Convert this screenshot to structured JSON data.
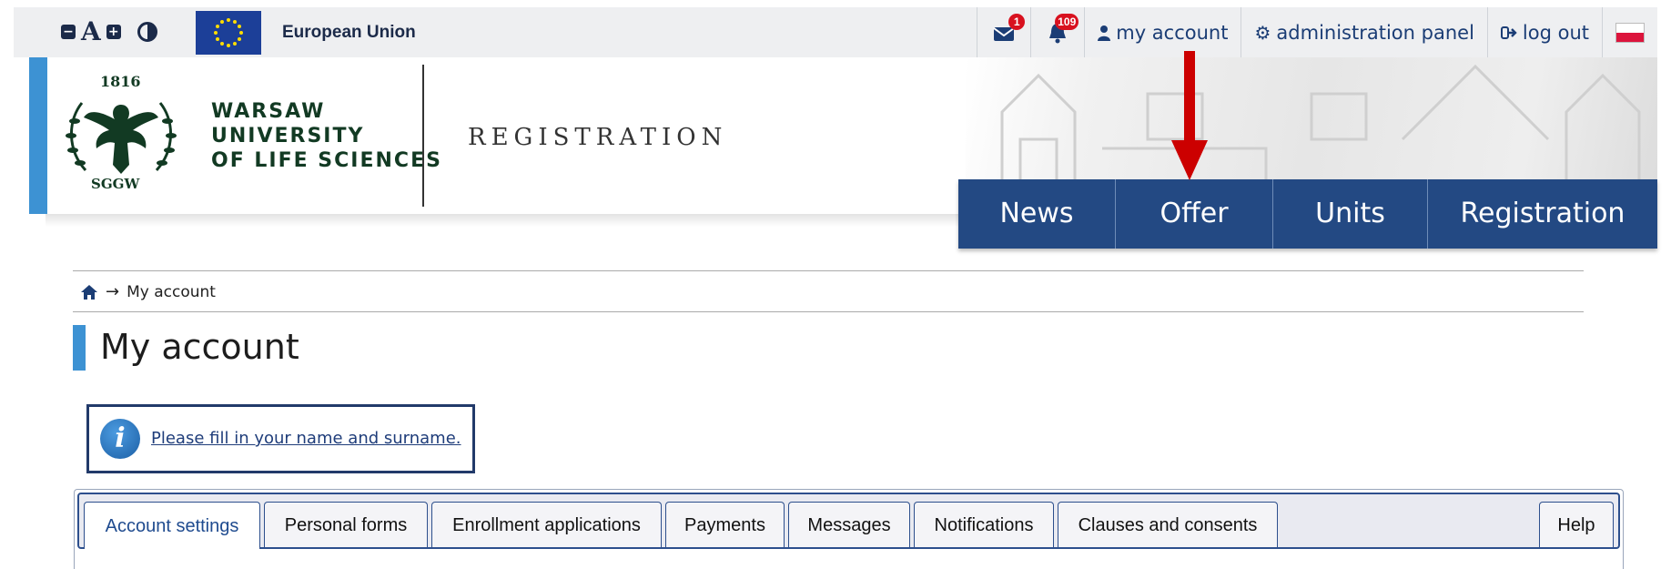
{
  "accessibility": {
    "decrease_font": "A−",
    "font_label": "A",
    "increase_font": "A+",
    "contrast": "contrast"
  },
  "eu": {
    "label": "European Union"
  },
  "topbar": {
    "messages_badge": "1",
    "notifications_badge": "109",
    "my_account": "my account",
    "admin_panel": "administration panel",
    "logout": "log out"
  },
  "header": {
    "logo_year": "1816",
    "logo_abbr": "SGGW",
    "uni_line1": "WARSAW",
    "uni_line2": "UNIVERSITY",
    "uni_line3": "OF LIFE SCIENCES",
    "registration": "REGISTRATION"
  },
  "nav": {
    "items": [
      {
        "label": "News"
      },
      {
        "label": "Offer"
      },
      {
        "label": "Units"
      },
      {
        "label": "Registration"
      }
    ]
  },
  "breadcrumb": {
    "current": "My account"
  },
  "page": {
    "title": "My account"
  },
  "info": {
    "message": "Please fill in your name and surname."
  },
  "tabs": {
    "items": [
      {
        "label": "Account settings"
      },
      {
        "label": "Personal forms"
      },
      {
        "label": "Enrollment applications"
      },
      {
        "label": "Payments"
      },
      {
        "label": "Messages"
      },
      {
        "label": "Notifications"
      },
      {
        "label": "Clauses and consents"
      },
      {
        "label": "Help"
      }
    ]
  },
  "colors": {
    "nav_bg": "#234983",
    "accent_blue": "#3d92d3",
    "arrow_red": "#cc0000",
    "badge_red": "#d8111f",
    "logo_green": "#123a23"
  }
}
